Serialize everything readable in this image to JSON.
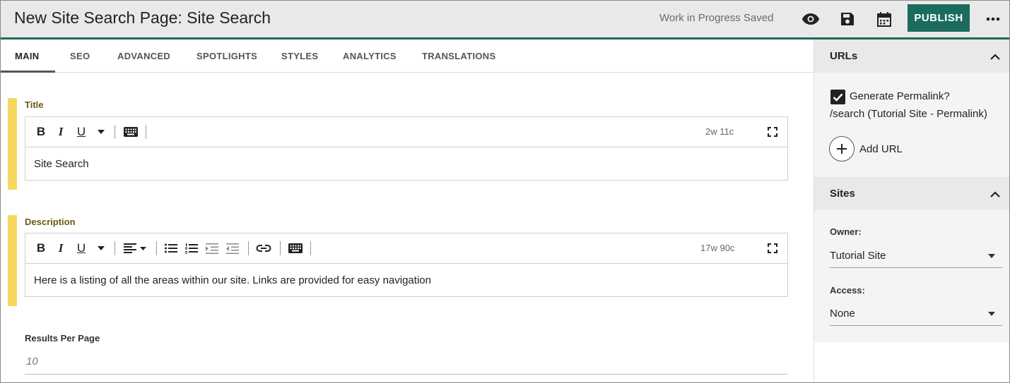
{
  "header": {
    "title": "New Site Search Page: Site Search",
    "status": "Work in Progress Saved",
    "publish_label": "PUBLISH"
  },
  "tabs": [
    {
      "label": "MAIN"
    },
    {
      "label": "SEO"
    },
    {
      "label": "ADVANCED"
    },
    {
      "label": "SPOTLIGHTS"
    },
    {
      "label": "STYLES"
    },
    {
      "label": "ANALYTICS"
    },
    {
      "label": "TRANSLATIONS"
    }
  ],
  "fields": {
    "title": {
      "label": "Title",
      "count": "2w 11c",
      "value": "Site Search"
    },
    "description": {
      "label": "Description",
      "count": "17w 90c",
      "value": "Here is a listing of all the areas within our site. Links are provided for easy navigation"
    },
    "results_per_page": {
      "label": "Results Per Page",
      "placeholder": "10"
    }
  },
  "toolbar": {
    "bold": "B",
    "italic": "I",
    "underline": "U"
  },
  "sidebar": {
    "urls": {
      "title": "URLs",
      "generate_label": "Generate Permalink?",
      "generate_checked": true,
      "permalink": "/search (Tutorial Site - Permalink)",
      "add_url_label": "Add URL"
    },
    "sites": {
      "title": "Sites",
      "owner_label": "Owner:",
      "owner_value": "Tutorial Site",
      "access_label": "Access:",
      "access_value": "None"
    }
  },
  "colors": {
    "accent": "#1b6b5f",
    "required_bar": "#f6d860",
    "label_gold": "#6b5a12",
    "header_bg": "#e9e9e9"
  },
  "icons": [
    "preview-eye-icon",
    "save-disk-icon",
    "calendar-icon",
    "more-dots-icon",
    "keyboard-icon",
    "fullscreen-icon",
    "align-left-icon",
    "bullet-list-icon",
    "numbered-list-icon",
    "indent-icon",
    "outdent-icon",
    "link-icon",
    "chevron-up-icon",
    "plus-icon",
    "checkmark-icon"
  ]
}
